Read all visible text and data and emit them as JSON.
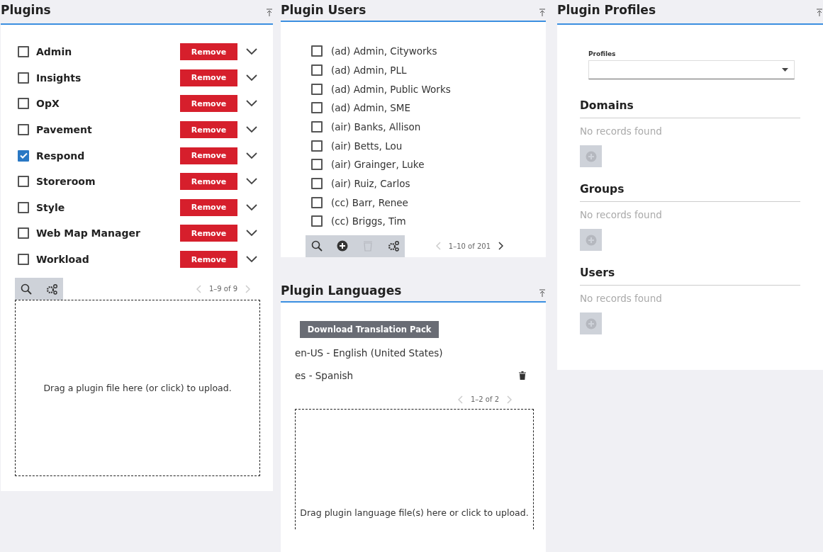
{
  "plugins": {
    "title": "Plugins",
    "items": [
      {
        "name": "Admin",
        "checked": false,
        "action": "Remove"
      },
      {
        "name": "Insights",
        "checked": false,
        "action": "Remove"
      },
      {
        "name": "OpX",
        "checked": false,
        "action": "Remove"
      },
      {
        "name": "Pavement",
        "checked": false,
        "action": "Remove"
      },
      {
        "name": "Respond",
        "checked": true,
        "action": "Remove"
      },
      {
        "name": "Storeroom",
        "checked": false,
        "action": "Remove"
      },
      {
        "name": "Style",
        "checked": false,
        "action": "Remove"
      },
      {
        "name": "Web Map Manager",
        "checked": false,
        "action": "Remove"
      },
      {
        "name": "Workload",
        "checked": false,
        "action": "Remove"
      }
    ],
    "toolbar": [
      {
        "kind": "search",
        "disabled": false
      },
      {
        "kind": "settings",
        "disabled": false
      }
    ],
    "pager": {
      "range": "1–9 of 9",
      "prev_disabled": true,
      "next_disabled": true
    },
    "dropzone": "Drag a plugin file here (or click) to upload."
  },
  "users": {
    "title": "Plugin Users",
    "items": [
      {
        "name": "(ad) Admin, Cityworks",
        "checked": false
      },
      {
        "name": "(ad) Admin, PLL",
        "checked": false
      },
      {
        "name": "(ad) Admin, Public Works",
        "checked": false
      },
      {
        "name": "(ad) Admin, SME",
        "checked": false
      },
      {
        "name": "(air) Banks, Allison",
        "checked": false
      },
      {
        "name": "(air) Betts, Lou",
        "checked": false
      },
      {
        "name": "(air) Grainger, Luke",
        "checked": false
      },
      {
        "name": "(air) Ruiz, Carlos",
        "checked": false
      },
      {
        "name": "(cc) Barr, Renee",
        "checked": false
      },
      {
        "name": "(cc) Briggs, Tim",
        "checked": false
      }
    ],
    "toolbar": [
      {
        "kind": "search",
        "disabled": false
      },
      {
        "kind": "add",
        "disabled": false
      },
      {
        "kind": "delete",
        "disabled": true
      },
      {
        "kind": "settings",
        "disabled": false
      }
    ],
    "pager": {
      "range": "1–10 of 201",
      "prev_disabled": true,
      "next_disabled": false
    }
  },
  "languages": {
    "title": "Plugin Languages",
    "download": "Download Translation Pack",
    "items": [
      {
        "name": "en-US - English (United States)",
        "deletable": false
      },
      {
        "name": "es - Spanish",
        "deletable": true
      }
    ],
    "pager": {
      "range": "1–2 of 2",
      "prev_disabled": true,
      "next_disabled": true
    },
    "dropzone": "Drag plugin language file(s) here or click to upload."
  },
  "profiles": {
    "title": "Plugin Profiles",
    "select_label": "Profiles",
    "sections": [
      {
        "title": "Domains",
        "empty": "No records found",
        "add_disabled": true
      },
      {
        "title": "Groups",
        "empty": "No records found",
        "add_disabled": true
      },
      {
        "title": "Users",
        "empty": "No records found",
        "add_disabled": true
      }
    ]
  }
}
